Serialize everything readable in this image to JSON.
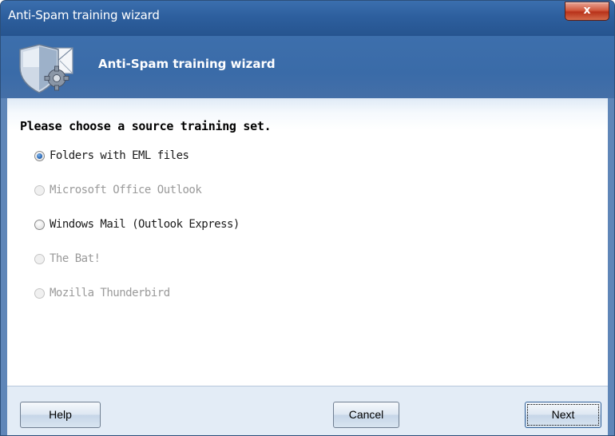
{
  "window": {
    "title": "Anti-Spam training wizard",
    "close_label": "x"
  },
  "header": {
    "title": "Anti-Spam training wizard",
    "icon": "shield-envelope-gear-icon"
  },
  "content": {
    "prompt": "Please choose a source training set.",
    "options": [
      {
        "label": "Folders with EML files",
        "checked": true,
        "enabled": true
      },
      {
        "label": "Microsoft Office Outlook",
        "checked": false,
        "enabled": false
      },
      {
        "label": "Windows Mail (Outlook Express)",
        "checked": false,
        "enabled": true
      },
      {
        "label": "The Bat!",
        "checked": false,
        "enabled": false
      },
      {
        "label": "Mozilla Thunderbird",
        "checked": false,
        "enabled": false
      }
    ]
  },
  "footer": {
    "help_label": "Help",
    "cancel_label": "Cancel",
    "next_label": "Next"
  },
  "colors": {
    "titlebar": "#2d5f9e",
    "header": "#3d6fac",
    "footer": "#e3ecf6",
    "disabled_text": "#9a9a9a"
  }
}
